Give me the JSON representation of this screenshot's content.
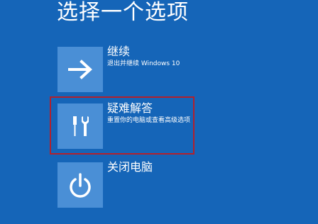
{
  "title": "选择一个选项",
  "options": [
    {
      "title": "继续",
      "description": "退出并继续 Windows 10",
      "icon": "arrow-right-icon"
    },
    {
      "title": "疑难解答",
      "description": "重置你的电脑或查看高级选项",
      "icon": "tools-icon"
    },
    {
      "title": "关闭电脑",
      "description": "",
      "icon": "power-icon"
    }
  ],
  "colors": {
    "background": "#1565b8",
    "tile": "#4a8fd6",
    "highlight": "#b3202c",
    "text": "#ffffff"
  }
}
